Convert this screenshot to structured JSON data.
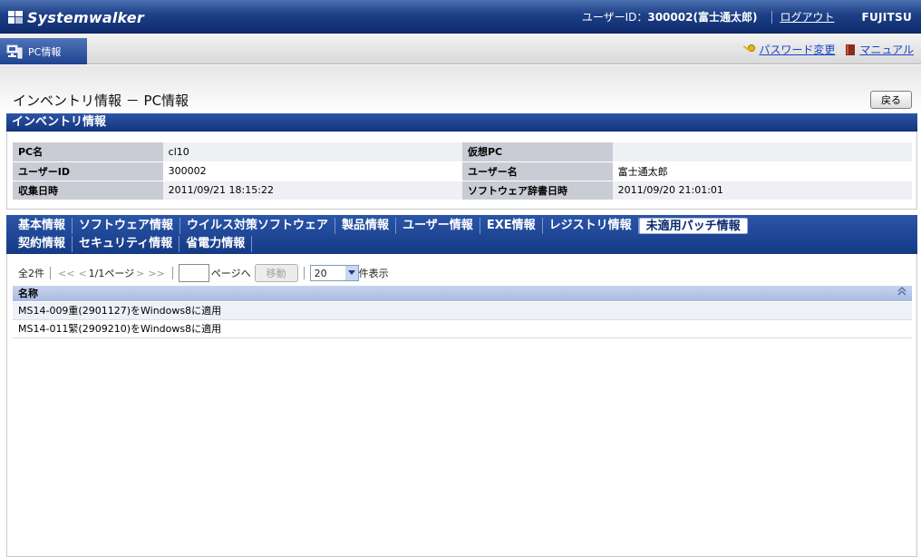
{
  "header": {
    "logo_text": "Systemwalker",
    "user_label": "ユーザーID：",
    "user_value": "300002(富士通太郎)",
    "logout": "ログアウト",
    "brand": "FUJITSU"
  },
  "subbar": {
    "tab_label": "PC情報",
    "password_change": "パスワード変更",
    "manual": "マニュアル"
  },
  "page": {
    "title": "インベントリ情報 － PC情報",
    "back_button": "戻る",
    "section_title": "インベントリ情報"
  },
  "info": {
    "rows": [
      {
        "l1": "PC名",
        "v1": "cl10",
        "l2": "仮想PC",
        "v2": ""
      },
      {
        "l1": "ユーザーID",
        "v1": "300002",
        "l2": "ユーザー名",
        "v2": "富士通太郎"
      },
      {
        "l1": "収集日時",
        "v1": "2011/09/21 18:15:22",
        "l2": "ソフトウェア辞書日時",
        "v2": "2011/09/20 21:01:01"
      }
    ]
  },
  "tabs": {
    "row1": [
      "基本情報",
      "ソフトウェア情報",
      "ウイルス対策ソフトウェア",
      "製品情報",
      "ユーザー情報",
      "EXE情報",
      "レジストリ情報",
      "未適用パッチ情報"
    ],
    "row2": [
      "契約情報",
      "セキュリティ情報",
      "省電力情報"
    ],
    "active": "未適用パッチ情報"
  },
  "pager": {
    "total": "全2件",
    "first": "<<",
    "prev": "<",
    "page_info": "1/1ページ",
    "next": ">",
    "last": ">>",
    "page_input_value": "",
    "go_label": "ページへ",
    "move_button": "移動",
    "per_page_value": "20",
    "per_page_suffix": "件表示"
  },
  "list": {
    "header": "名称",
    "rows": [
      "MS14-009重(2901127)をWindows8に適用",
      "MS14-011緊(2909210)をWindows8に適用"
    ]
  },
  "colors": {
    "header_blue": "#1d3f86",
    "link_blue": "#1a44c6",
    "active_tab_text": "#0c2a6d"
  }
}
